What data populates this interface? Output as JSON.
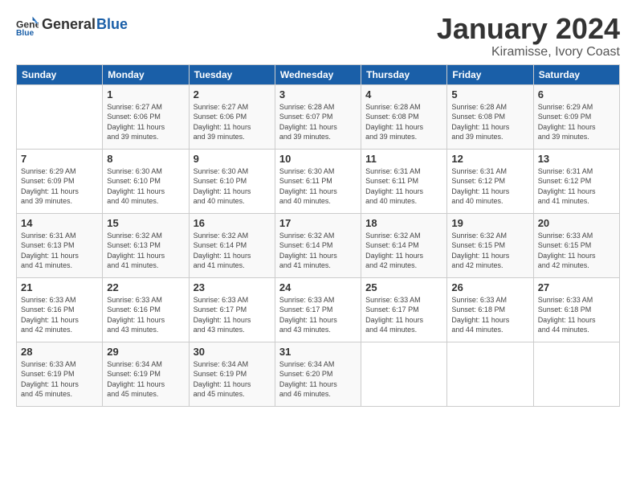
{
  "header": {
    "logo_general": "General",
    "logo_blue": "Blue",
    "month": "January 2024",
    "location": "Kiramisse, Ivory Coast"
  },
  "days_of_week": [
    "Sunday",
    "Monday",
    "Tuesday",
    "Wednesday",
    "Thursday",
    "Friday",
    "Saturday"
  ],
  "weeks": [
    [
      {
        "day": "",
        "info": ""
      },
      {
        "day": "1",
        "info": "Sunrise: 6:27 AM\nSunset: 6:06 PM\nDaylight: 11 hours\nand 39 minutes."
      },
      {
        "day": "2",
        "info": "Sunrise: 6:27 AM\nSunset: 6:06 PM\nDaylight: 11 hours\nand 39 minutes."
      },
      {
        "day": "3",
        "info": "Sunrise: 6:28 AM\nSunset: 6:07 PM\nDaylight: 11 hours\nand 39 minutes."
      },
      {
        "day": "4",
        "info": "Sunrise: 6:28 AM\nSunset: 6:08 PM\nDaylight: 11 hours\nand 39 minutes."
      },
      {
        "day": "5",
        "info": "Sunrise: 6:28 AM\nSunset: 6:08 PM\nDaylight: 11 hours\nand 39 minutes."
      },
      {
        "day": "6",
        "info": "Sunrise: 6:29 AM\nSunset: 6:09 PM\nDaylight: 11 hours\nand 39 minutes."
      }
    ],
    [
      {
        "day": "7",
        "info": "Sunrise: 6:29 AM\nSunset: 6:09 PM\nDaylight: 11 hours\nand 39 minutes."
      },
      {
        "day": "8",
        "info": "Sunrise: 6:30 AM\nSunset: 6:10 PM\nDaylight: 11 hours\nand 40 minutes."
      },
      {
        "day": "9",
        "info": "Sunrise: 6:30 AM\nSunset: 6:10 PM\nDaylight: 11 hours\nand 40 minutes."
      },
      {
        "day": "10",
        "info": "Sunrise: 6:30 AM\nSunset: 6:11 PM\nDaylight: 11 hours\nand 40 minutes."
      },
      {
        "day": "11",
        "info": "Sunrise: 6:31 AM\nSunset: 6:11 PM\nDaylight: 11 hours\nand 40 minutes."
      },
      {
        "day": "12",
        "info": "Sunrise: 6:31 AM\nSunset: 6:12 PM\nDaylight: 11 hours\nand 40 minutes."
      },
      {
        "day": "13",
        "info": "Sunrise: 6:31 AM\nSunset: 6:12 PM\nDaylight: 11 hours\nand 41 minutes."
      }
    ],
    [
      {
        "day": "14",
        "info": "Sunrise: 6:31 AM\nSunset: 6:13 PM\nDaylight: 11 hours\nand 41 minutes."
      },
      {
        "day": "15",
        "info": "Sunrise: 6:32 AM\nSunset: 6:13 PM\nDaylight: 11 hours\nand 41 minutes."
      },
      {
        "day": "16",
        "info": "Sunrise: 6:32 AM\nSunset: 6:14 PM\nDaylight: 11 hours\nand 41 minutes."
      },
      {
        "day": "17",
        "info": "Sunrise: 6:32 AM\nSunset: 6:14 PM\nDaylight: 11 hours\nand 41 minutes."
      },
      {
        "day": "18",
        "info": "Sunrise: 6:32 AM\nSunset: 6:14 PM\nDaylight: 11 hours\nand 42 minutes."
      },
      {
        "day": "19",
        "info": "Sunrise: 6:32 AM\nSunset: 6:15 PM\nDaylight: 11 hours\nand 42 minutes."
      },
      {
        "day": "20",
        "info": "Sunrise: 6:33 AM\nSunset: 6:15 PM\nDaylight: 11 hours\nand 42 minutes."
      }
    ],
    [
      {
        "day": "21",
        "info": "Sunrise: 6:33 AM\nSunset: 6:16 PM\nDaylight: 11 hours\nand 42 minutes."
      },
      {
        "day": "22",
        "info": "Sunrise: 6:33 AM\nSunset: 6:16 PM\nDaylight: 11 hours\nand 43 minutes."
      },
      {
        "day": "23",
        "info": "Sunrise: 6:33 AM\nSunset: 6:17 PM\nDaylight: 11 hours\nand 43 minutes."
      },
      {
        "day": "24",
        "info": "Sunrise: 6:33 AM\nSunset: 6:17 PM\nDaylight: 11 hours\nand 43 minutes."
      },
      {
        "day": "25",
        "info": "Sunrise: 6:33 AM\nSunset: 6:17 PM\nDaylight: 11 hours\nand 44 minutes."
      },
      {
        "day": "26",
        "info": "Sunrise: 6:33 AM\nSunset: 6:18 PM\nDaylight: 11 hours\nand 44 minutes."
      },
      {
        "day": "27",
        "info": "Sunrise: 6:33 AM\nSunset: 6:18 PM\nDaylight: 11 hours\nand 44 minutes."
      }
    ],
    [
      {
        "day": "28",
        "info": "Sunrise: 6:33 AM\nSunset: 6:19 PM\nDaylight: 11 hours\nand 45 minutes."
      },
      {
        "day": "29",
        "info": "Sunrise: 6:34 AM\nSunset: 6:19 PM\nDaylight: 11 hours\nand 45 minutes."
      },
      {
        "day": "30",
        "info": "Sunrise: 6:34 AM\nSunset: 6:19 PM\nDaylight: 11 hours\nand 45 minutes."
      },
      {
        "day": "31",
        "info": "Sunrise: 6:34 AM\nSunset: 6:20 PM\nDaylight: 11 hours\nand 46 minutes."
      },
      {
        "day": "",
        "info": ""
      },
      {
        "day": "",
        "info": ""
      },
      {
        "day": "",
        "info": ""
      }
    ]
  ]
}
